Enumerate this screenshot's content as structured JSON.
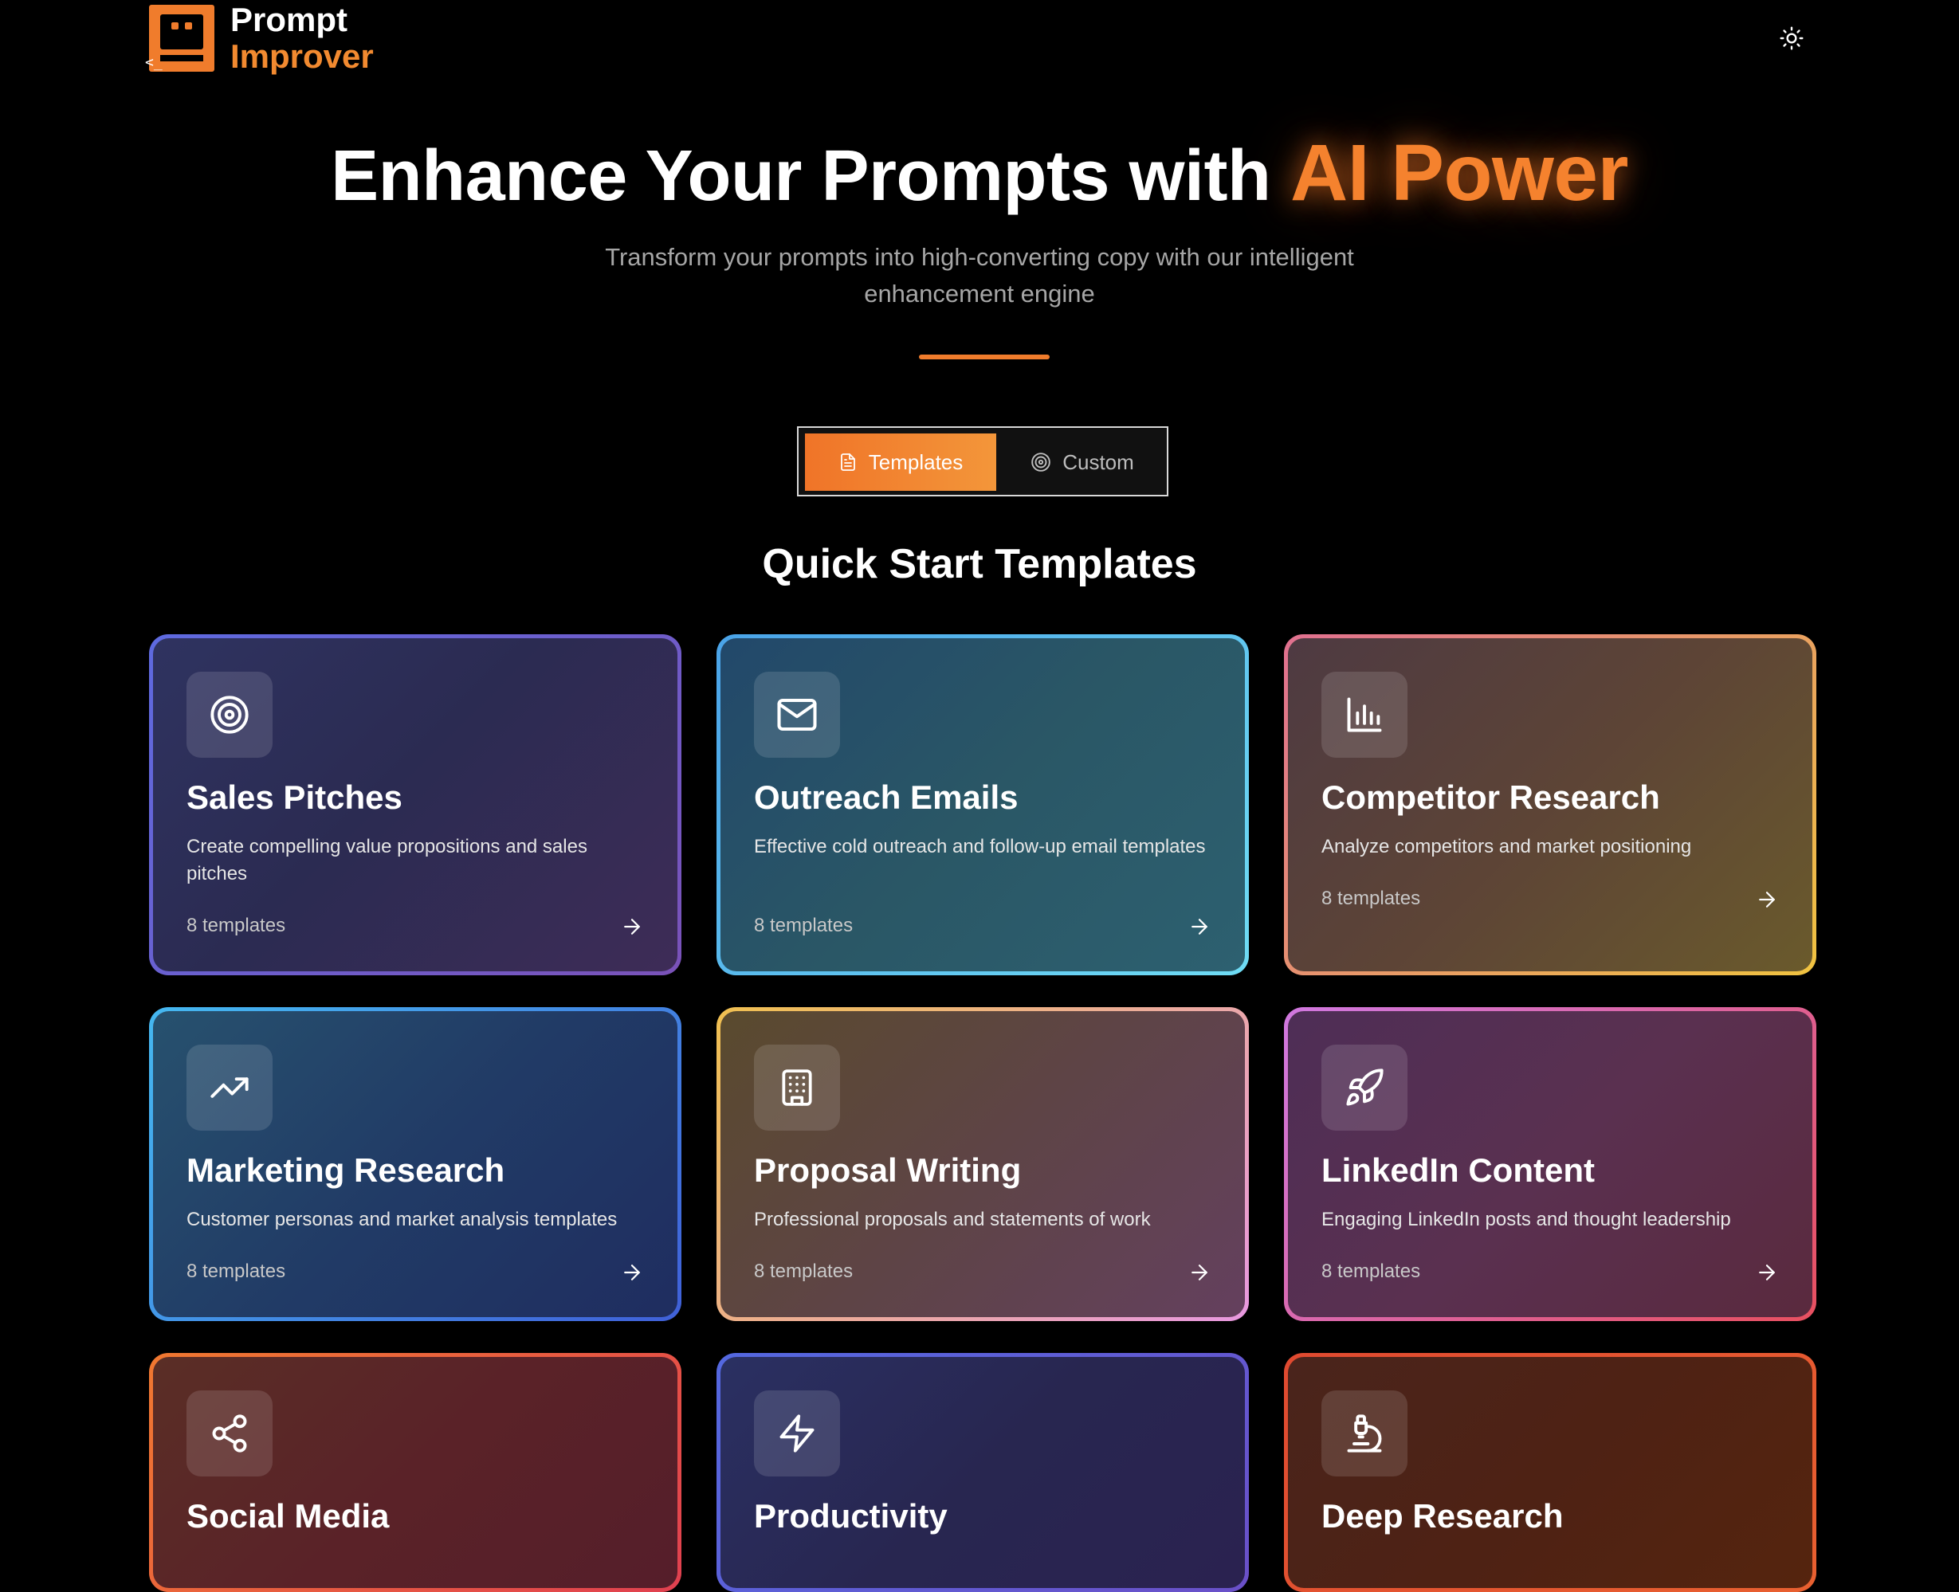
{
  "header": {
    "logo_line1": "Prompt",
    "logo_line2": "Improver",
    "logo_glyph": "<_",
    "theme_icon": "sun-icon"
  },
  "hero": {
    "title_main": "Enhance Your Prompts with ",
    "title_accent": "AI Power",
    "subtitle": "Transform your prompts into high-converting copy with our intelligent enhancement engine"
  },
  "modes": {
    "templates_label": "Templates",
    "custom_label": "Custom",
    "selected": "Templates"
  },
  "section": {
    "title": "Quick Start Templates"
  },
  "colors": {
    "accent": "#f28a30",
    "background": "#000000"
  },
  "cards": [
    {
      "title": "Sales Pitches",
      "description": "Create compelling value propositions and sales pitches",
      "count": "8 templates",
      "icon": "target-icon"
    },
    {
      "title": "Outreach Emails",
      "description": "Effective cold outreach and follow-up email templates",
      "count": "8 templates",
      "icon": "mail-icon"
    },
    {
      "title": "Competitor Research",
      "description": "Analyze competitors and market positioning",
      "count": "8 templates",
      "icon": "bar-chart-icon"
    },
    {
      "title": "Marketing Research",
      "description": "Customer personas and market analysis templates",
      "count": "8 templates",
      "icon": "trending-up-icon"
    },
    {
      "title": "Proposal Writing",
      "description": "Professional proposals and statements of work",
      "count": "8 templates",
      "icon": "building-icon"
    },
    {
      "title": "LinkedIn Content",
      "description": "Engaging LinkedIn posts and thought leadership",
      "count": "8 templates",
      "icon": "rocket-icon"
    },
    {
      "title": "Social Media",
      "description": "",
      "count": "",
      "icon": "share-icon"
    },
    {
      "title": "Productivity",
      "description": "",
      "count": "",
      "icon": "zap-icon"
    },
    {
      "title": "Deep Research",
      "description": "",
      "count": "",
      "icon": "microscope-icon"
    }
  ]
}
